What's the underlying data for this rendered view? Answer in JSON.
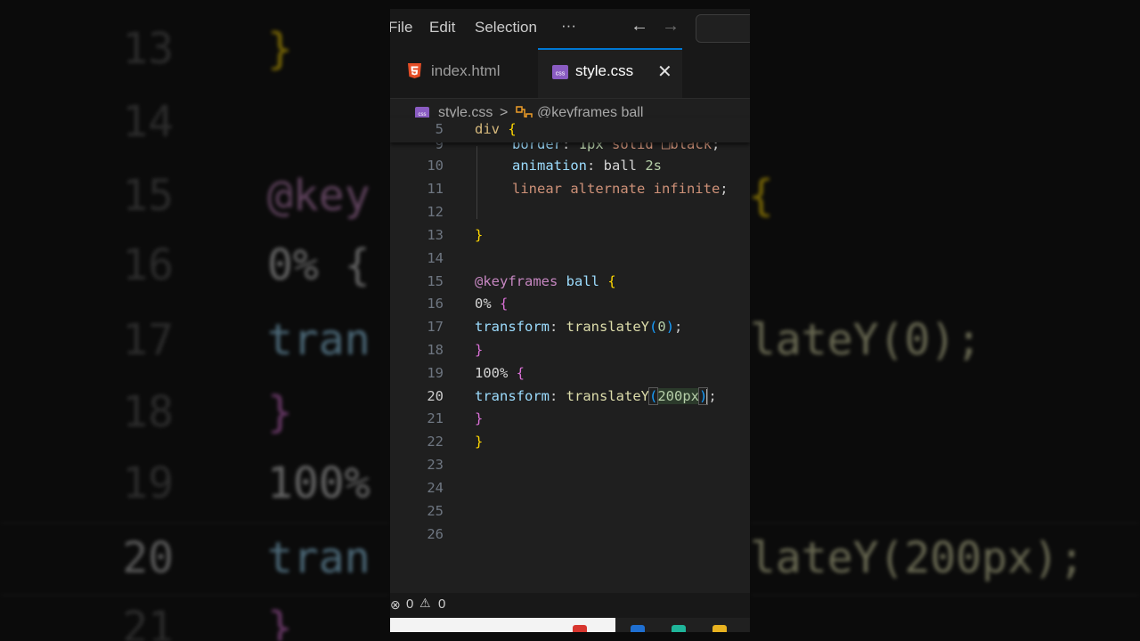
{
  "menu": {
    "file": "File",
    "edit": "Edit",
    "selection": "Selection",
    "more": "···",
    "back": "←",
    "forward": "→"
  },
  "tabs": [
    {
      "label": "index.html",
      "icon": "html5-icon",
      "active": false
    },
    {
      "label": "style.css",
      "icon": "css-icon",
      "active": true,
      "close": "✕"
    }
  ],
  "breadcrumb": {
    "file": "style.css",
    "separator": ">",
    "symbol": "@keyframes ball"
  },
  "sticky": {
    "number": "5",
    "text": "div {"
  },
  "code_lines": [
    {
      "n": "9",
      "partial": "border: 1px solid □black;"
    },
    {
      "n": "10",
      "text": "animation: ball 2s"
    },
    {
      "n": "11",
      "text": "linear alternate infinite;"
    },
    {
      "n": "12",
      "text": ""
    },
    {
      "n": "13",
      "text": "}"
    },
    {
      "n": "14",
      "text": ""
    },
    {
      "n": "15",
      "text": "@keyframes ball {"
    },
    {
      "n": "16",
      "text": "0% {"
    },
    {
      "n": "17",
      "text": "transform: translateY(0);"
    },
    {
      "n": "18",
      "text": "}"
    },
    {
      "n": "19",
      "text": "100% {"
    },
    {
      "n": "20",
      "text": "transform: translateY(200px);",
      "active": true
    },
    {
      "n": "21",
      "text": "}"
    },
    {
      "n": "22",
      "text": "}"
    },
    {
      "n": "23",
      "text": ""
    },
    {
      "n": "24",
      "text": ""
    },
    {
      "n": "25",
      "text": ""
    },
    {
      "n": "26",
      "text": ""
    }
  ],
  "status": {
    "errors": "0",
    "warnings": "0"
  },
  "background": {
    "left": [
      {
        "n": "13",
        "code": "}"
      },
      {
        "n": "14",
        "code": ""
      },
      {
        "n": "15",
        "code": "@key"
      },
      {
        "n": "16",
        "code": "0% {"
      },
      {
        "n": "17",
        "code": "tran"
      },
      {
        "n": "18",
        "code": "}"
      },
      {
        "n": "19",
        "code": "100%"
      },
      {
        "n": "20",
        "code": "tran"
      },
      {
        "n": "21",
        "code": "}"
      }
    ],
    "right": [
      {
        "code": "{"
      },
      {
        "code": "lateY(0);"
      },
      {
        "code": "lateY(200px);"
      }
    ]
  },
  "colors": {
    "selector": "#d7ba7d",
    "property": "#9cdcfe",
    "value": "#ce9178",
    "number": "#b5cea8",
    "function": "#dcdcaa",
    "at_rule": "#c586c0",
    "bracket1": "#ffd700",
    "bracket2": "#da70d6",
    "bracket3": "#179fff",
    "tab_accent": "#0078d4"
  }
}
